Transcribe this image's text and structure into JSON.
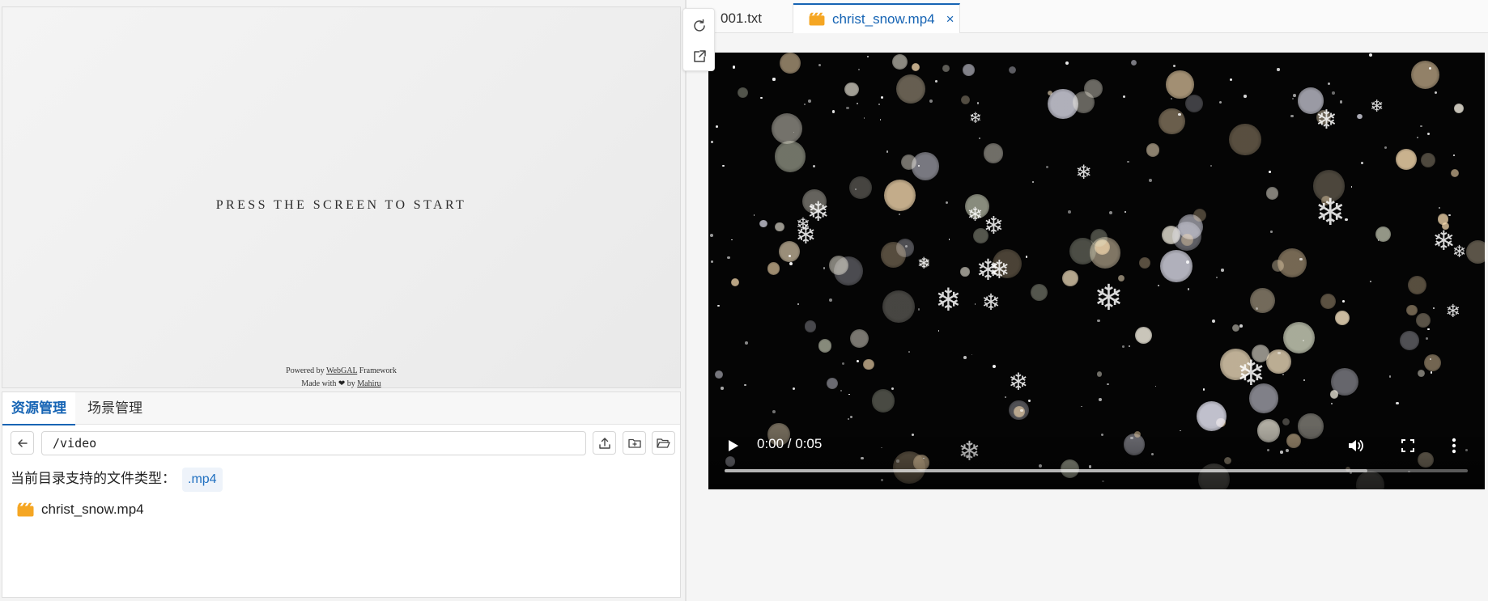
{
  "preview": {
    "press_text": "PRESS THE SCREEN TO START",
    "powered_prefix": "Powered by",
    "powered_link": "WebGAL",
    "powered_suffix": "Framework",
    "made_prefix": "Made with",
    "made_by": "by",
    "made_link": "Mahiru"
  },
  "left_panel": {
    "tabs": [
      {
        "label": "资源管理",
        "active": true
      },
      {
        "label": "场景管理",
        "active": false
      }
    ],
    "path": "/video",
    "supported_types_label": "当前目录支持的文件类型：",
    "supported_types": [
      ".mp4"
    ],
    "files": [
      {
        "name": "christ_snow.mp4",
        "icon": "video-file-icon"
      }
    ]
  },
  "side_tools": [
    "refresh-icon",
    "open-external-icon"
  ],
  "editor": {
    "tabs": [
      {
        "label": "001.txt",
        "active": false
      },
      {
        "label": "christ_snow.mp4",
        "active": true,
        "icon": "video-file-icon",
        "closable": true
      }
    ],
    "close_glyph": "×"
  },
  "video": {
    "time": "0:00 / 0:05",
    "progress": 0,
    "buffered": 0.865
  },
  "colors": {
    "accent": "#1664b4",
    "file_icon": "#f5a623",
    "video_bg": "#050505"
  }
}
